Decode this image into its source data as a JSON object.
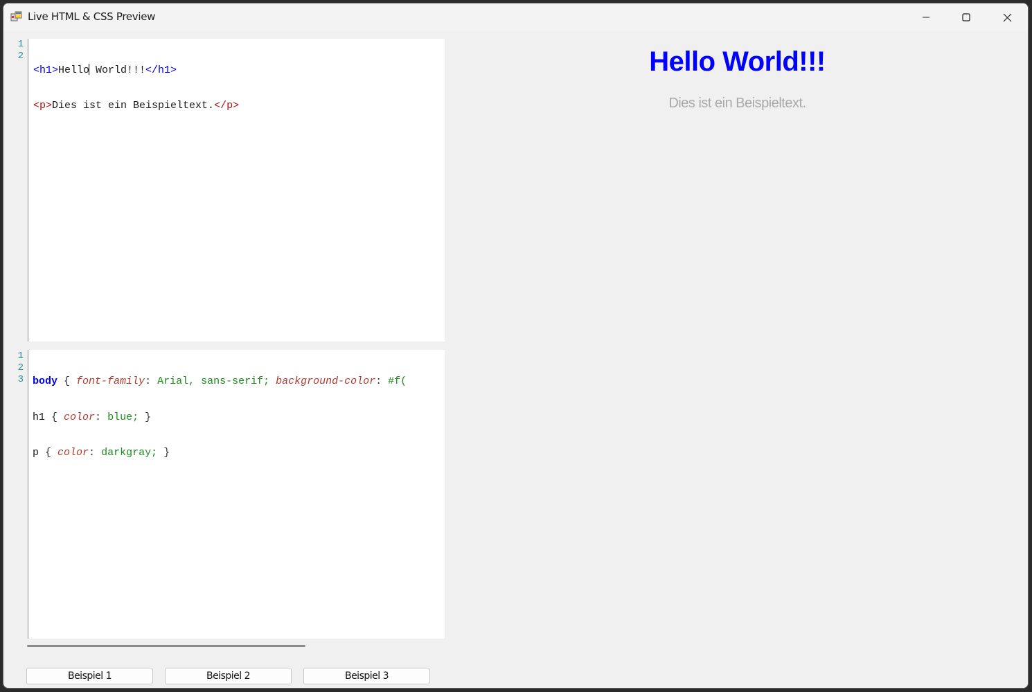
{
  "window": {
    "title": "Live HTML & CSS Preview"
  },
  "html_editor": {
    "line_numbers": [
      "1",
      "2"
    ],
    "lines": [
      {
        "t1": "<h1>",
        "t2": "Hello",
        "t3": " World!!!",
        "t4": "</h1>"
      },
      {
        "t1": "<p>",
        "t2": "Dies ist ein Beispieltext.",
        "t3": "</p>"
      }
    ]
  },
  "css_editor": {
    "line_numbers": [
      "1",
      "2",
      "3"
    ],
    "line1": {
      "sel": "body",
      "b1": " { ",
      "p1": "font-family",
      "c1": ": ",
      "v1": "Arial, sans-serif;",
      "s1": " ",
      "p2": "background-color",
      "c2": ": ",
      "v2": "#f("
    },
    "line2": {
      "sel": "h1",
      "b1": " { ",
      "p1": "color",
      "c1": ": ",
      "v1": "blue;",
      "b2": " }"
    },
    "line3": {
      "sel": "p",
      "b1": " { ",
      "p1": "color",
      "c1": ": ",
      "v1": "darkgray;",
      "b2": " }"
    }
  },
  "buttons": {
    "example1": "Beispiel 1",
    "example2": "Beispiel 2",
    "example3": "Beispiel 3"
  },
  "preview": {
    "heading": "Hello World!!!",
    "paragraph": "Dies ist ein Beispieltext.",
    "heading_color": "#0000ff",
    "paragraph_color": "#a9a9a9"
  }
}
